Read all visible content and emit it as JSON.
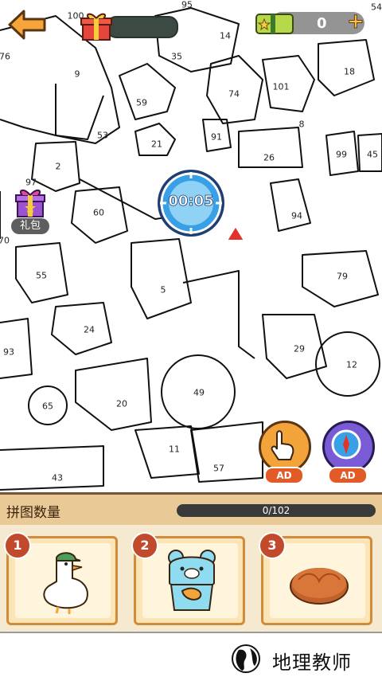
{
  "top_bar": {
    "back_icon": "back-arrow-icon",
    "gift_icon": "gift-box-icon",
    "gift_progress": 0.02,
    "ticket_icon": "ticket-icon",
    "ticket_count": "0",
    "plus_label": "+"
  },
  "timer": {
    "value": "00:05",
    "icon": "compass-timer-icon"
  },
  "gift_pack": {
    "label": "礼包",
    "icon": "gift-pack-icon"
  },
  "ad_buttons": [
    {
      "icon": "hand-tap-icon",
      "label": "AD"
    },
    {
      "icon": "compass-icon",
      "label": "AD"
    }
  ],
  "region_numbers": [
    "100",
    "95",
    "14",
    "35",
    "76",
    "9",
    "18",
    "101",
    "74",
    "59",
    "53",
    "8",
    "21",
    "91",
    "26",
    "2",
    "97",
    "99",
    "45",
    "60",
    "94",
    "70",
    "55",
    "5",
    "79",
    "24",
    "29",
    "93",
    "12",
    "20",
    "49",
    "65",
    "11",
    "57",
    "43",
    "54"
  ],
  "panel": {
    "title": "拼图数量",
    "progress_text": "0/102",
    "progress_value": 0,
    "cards": [
      {
        "badge": "1",
        "art": "duck-with-cap-icon"
      },
      {
        "badge": "2",
        "art": "blue-bear-with-fish-icon"
      },
      {
        "badge": "3",
        "art": "orange-cookie-icon"
      }
    ]
  },
  "watermark": {
    "text": "地理教师",
    "logo": "globe-logo-icon"
  }
}
